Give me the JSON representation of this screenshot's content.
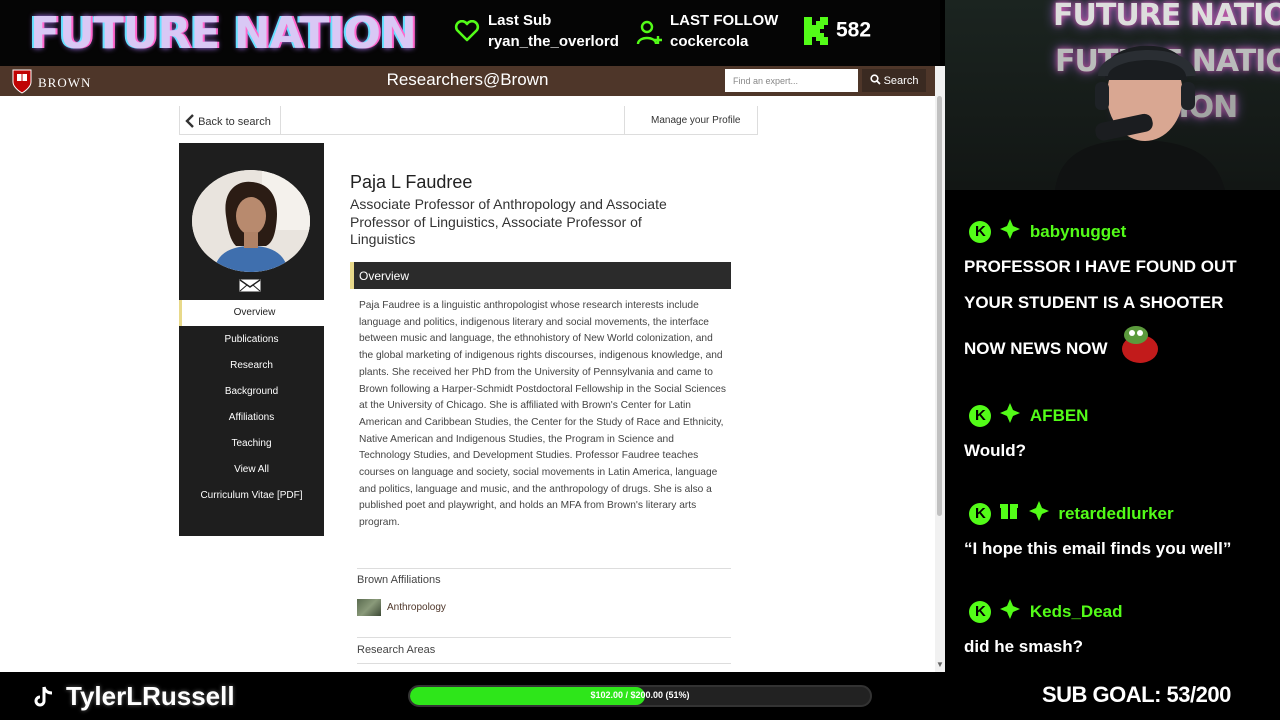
{
  "stream": {
    "brand_title": "FUTURE NATION",
    "last_sub_label": "Last Sub",
    "last_sub_user": "ryan_the_overlord",
    "last_follow_label": "LAST FOLLOW",
    "last_follow_user": "cockercola",
    "kick_count": "582",
    "accent_color": "#53fc18",
    "streamer_name": "TylerLRussell",
    "goal_text": "$102.00 / $200.00 (51%)",
    "goal_progress": 0.51,
    "sub_goal": "SUB GOAL: 53/200",
    "webcam_neon": [
      "FUTURE NATION",
      "FUTURE NATION",
      "NATION"
    ]
  },
  "site": {
    "wordmark": "BROWN",
    "title": "Researchers@Brown",
    "search_placeholder": "Find an expert...",
    "search_button": "Search",
    "back_link": "Back to search",
    "manage_link": "Manage your Profile",
    "brand_color": "#4e3629"
  },
  "profile": {
    "name": "Paja L Faudree",
    "title": "Associate Professor of Anthropology and Associate Professor of Linguistics, Associate Professor of Linguistics",
    "sidebar": [
      "Overview",
      "Publications",
      "Research",
      "Background",
      "Affiliations",
      "Teaching",
      "View All",
      "Curriculum Vitae [PDF]"
    ],
    "overview_heading": "Overview",
    "overview_text": "Paja Faudree is a linguistic anthropologist whose research interests include language and politics, indigenous literary and social movements, the interface between music and language, the ethnohistory of New World colonization, and the global marketing of indigenous rights discourses, indigenous knowledge, and plants. She received her PhD from the University of Pennsylvania and came to Brown following a Harper-Schmidt Postdoctoral Fellowship in the Social Sciences at the University of Chicago. She is affiliated with Brown's Center for Latin American and Caribbean Studies, the Center for the Study of Race and Ethnicity, Native American and Indigenous Studies, the Program in Science and Technology Studies, and Development Studies. Professor Faudree teaches courses on language and society, social movements in Latin America, language and politics, language and music, and the anthropology of drugs. She is also a published poet and playwright, and holds an MFA from Brown's literary arts program.",
    "affiliations_heading": "Brown Affiliations",
    "affiliation": "Anthropology",
    "research_heading": "Research Areas"
  },
  "chat": [
    {
      "user": "babynugget",
      "message": "PROFESSOR I HAVE FOUND OUT YOUR STUDENT IS A SHOOTER NOW NEWS NOW"
    },
    {
      "user": "AFBEN",
      "message": "Would?"
    },
    {
      "user": "retardedlurker",
      "message": "“I hope this email finds you well”"
    },
    {
      "user": "Keds_Dead",
      "message": "did he smash?"
    }
  ]
}
